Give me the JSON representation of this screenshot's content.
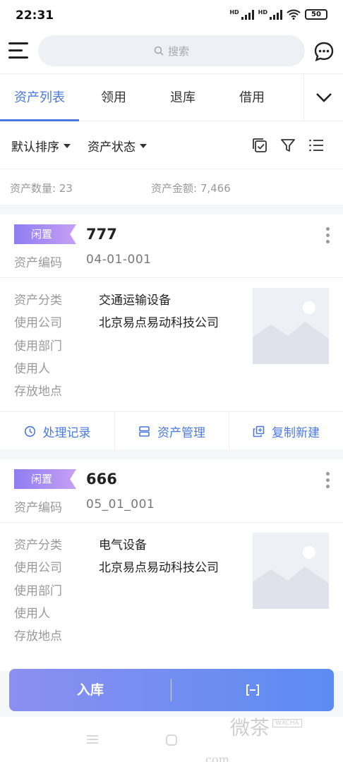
{
  "status_bar": {
    "time": "22:31",
    "hd1": "HD",
    "hd2": "HD",
    "battery": "50"
  },
  "search": {
    "placeholder": "搜索"
  },
  "tabs": [
    {
      "label": "资产列表",
      "active": true
    },
    {
      "label": "领用"
    },
    {
      "label": "退库"
    },
    {
      "label": "借用"
    }
  ],
  "filters": {
    "sort": "默认排序",
    "status": "资产状态"
  },
  "summary": {
    "count_label": "资产数量: 23",
    "amount_label": "资产金额: 7,466"
  },
  "labels": {
    "code": "资产编码",
    "category": "资产分类",
    "company": "使用公司",
    "department": "使用部门",
    "user": "使用人",
    "location": "存放地点"
  },
  "assets": [
    {
      "status": "闲置",
      "name": "777",
      "code": "04-01-001",
      "category": "交通运输设备",
      "company": "北京易点易动科技公司",
      "department": "",
      "user": "",
      "location": ""
    },
    {
      "status": "闲置",
      "name": "666",
      "code": "05_01_001",
      "category": "电气设备",
      "company": "北京易点易动科技公司",
      "department": "",
      "user": "",
      "location": ""
    }
  ],
  "card_actions": {
    "records": "处理记录",
    "manage": "资产管理",
    "copy": "复制新建"
  },
  "bottom": {
    "primary": "入库"
  },
  "watermark": {
    "text": "微茶",
    "sub": "WXCHA",
    "domain": ".com"
  },
  "colors": {
    "accent": "#4a78e0",
    "badge_start": "#8f7df2",
    "badge_end": "#c6a0f5",
    "button_start": "#8b8ff0",
    "button_end": "#5b8cf2"
  }
}
